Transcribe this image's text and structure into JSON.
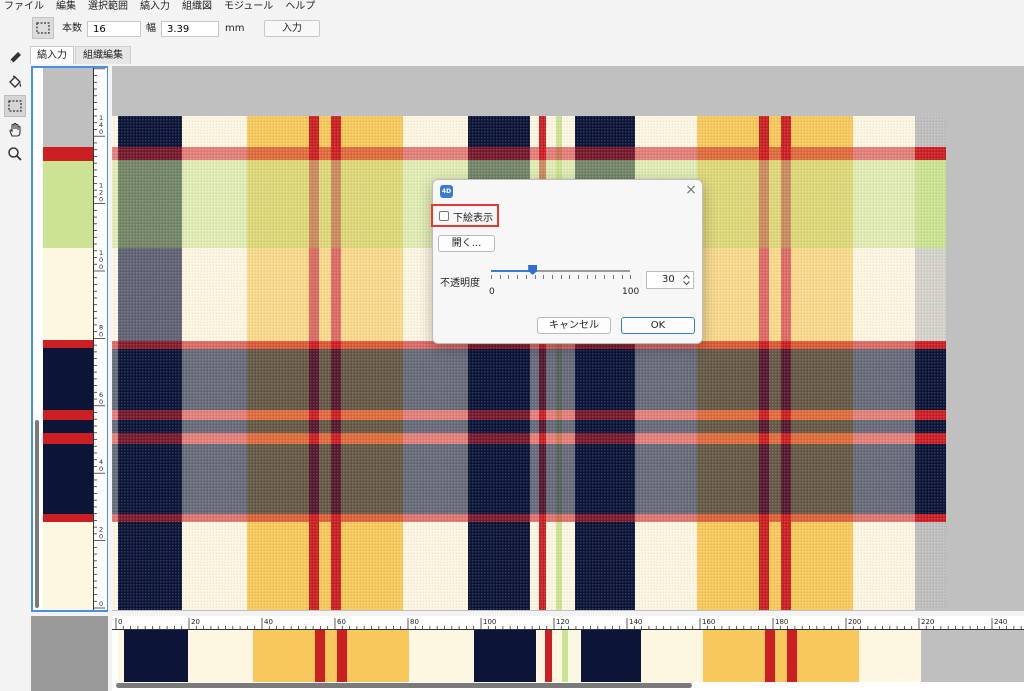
{
  "menu": {
    "items": [
      "ファイル",
      "編集",
      "選択範囲",
      "縞入力",
      "組織図",
      "モジュール",
      "ヘルプ"
    ]
  },
  "toolbar": {
    "count_label": "本数",
    "count_value": "16",
    "width_label": "幅",
    "width_value": "3.39",
    "unit_label": "mm",
    "enter_button": "入力"
  },
  "tabs": [
    {
      "label": "縞入力",
      "active": true
    },
    {
      "label": "組織編集",
      "active": false
    }
  ],
  "tools": [
    "pencil-icon",
    "paint-bucket-icon",
    "rect-select-icon",
    "hand-icon",
    "zoom-icon"
  ],
  "vertical_ruler": {
    "labels": [
      "140",
      "120",
      "100",
      "80",
      "60",
      "40",
      "20",
      "0"
    ]
  },
  "horizontal_ruler": {
    "labels": [
      "0",
      "20",
      "40",
      "60",
      "80",
      "100",
      "120",
      "140",
      "160",
      "180",
      "200",
      "220",
      "240"
    ]
  },
  "colors": {
    "navy": "#0c1538",
    "cream": "#fdf6e1",
    "yellow": "#f7c95c",
    "red": "#cc1f24",
    "green": "#cbe392",
    "gray": "#bfbfbf",
    "accent": "#3c7bd2",
    "highlight": "#e53935"
  },
  "dialog": {
    "app_icon": "4D",
    "close_icon": "×",
    "checkbox_label": "下絵表示",
    "checkbox_checked": false,
    "open_button": "開く...",
    "opacity_label": "不透明度",
    "slider_min": "0",
    "slider_max": "100",
    "slider_value": 30,
    "opacity_value": "30",
    "cancel_button": "キャンセル",
    "ok_button": "OK"
  }
}
